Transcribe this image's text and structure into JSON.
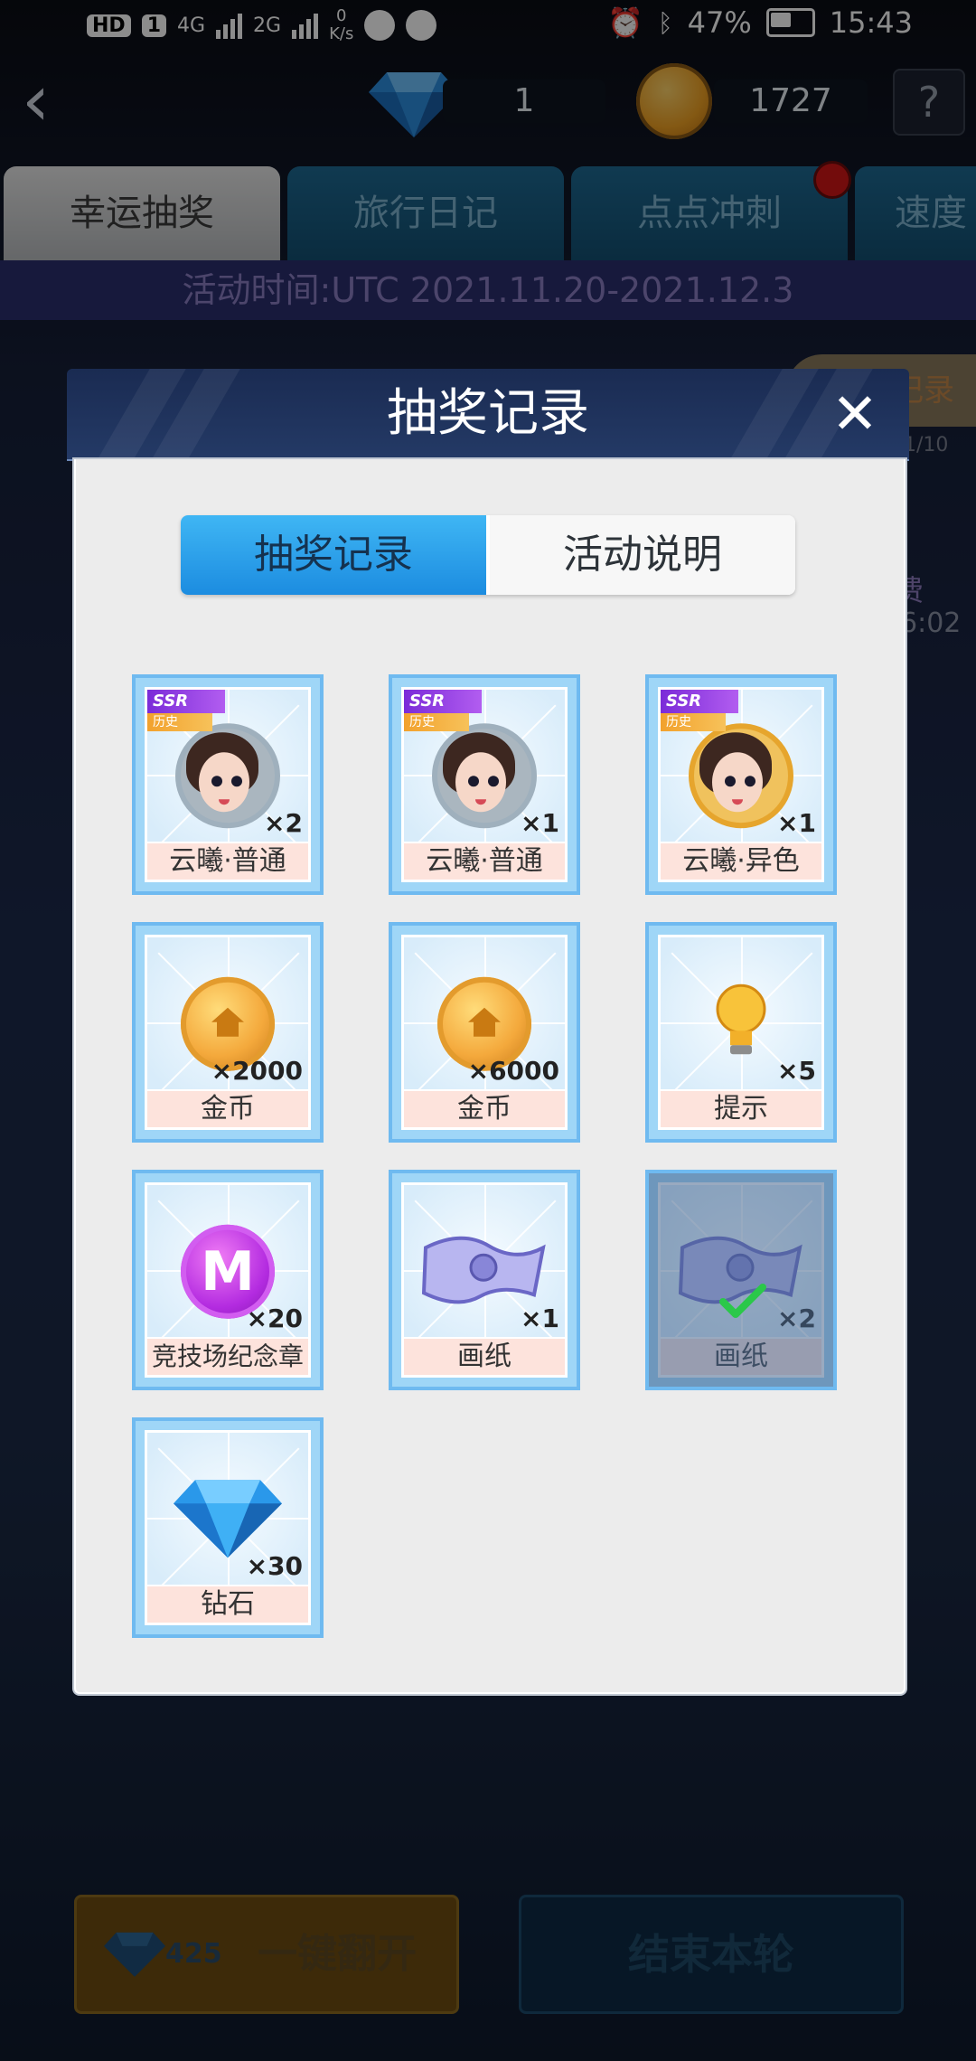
{
  "status_bar": {
    "hd": "HD",
    "sim1": "1",
    "net1": "4G",
    "net2": "2G",
    "speed_value": "0",
    "speed_unit": "K/s",
    "battery": "47%",
    "time": "15:43"
  },
  "top_bar": {
    "diamond_count": "1",
    "coin_count": "1727",
    "help_label": "?"
  },
  "tabs": [
    {
      "label": "幸运抽奖"
    },
    {
      "label": "旅行日记"
    },
    {
      "label": "点点冲刺"
    },
    {
      "label": "速度"
    }
  ],
  "event_time": "活动时间:UTC 2021.11.20-2021.12.3",
  "background_hints": {
    "side_chip": "记录",
    "count": "1/10",
    "fee": "费",
    "time": "6:02"
  },
  "modal": {
    "title": "抽奖记录",
    "close": "✕",
    "tabs": [
      "抽奖记录",
      "活动说明"
    ],
    "items": [
      {
        "name": "云曦·普通",
        "qty": "×2",
        "icon": "avatar-silver",
        "ssr": "SSR",
        "history": "历史"
      },
      {
        "name": "云曦·普通",
        "qty": "×1",
        "icon": "avatar-silver",
        "ssr": "SSR",
        "history": "历史"
      },
      {
        "name": "云曦·异色",
        "qty": "×1",
        "icon": "avatar-gold",
        "ssr": "SSR",
        "history": "历史"
      },
      {
        "name": "金币",
        "qty": "×2000",
        "icon": "coin"
      },
      {
        "name": "金币",
        "qty": "×6000",
        "icon": "coin"
      },
      {
        "name": "提示",
        "qty": "×5",
        "icon": "bulb"
      },
      {
        "name": "竞技场纪念章",
        "qty": "×20",
        "icon": "medal",
        "medal_letter": "M"
      },
      {
        "name": "画纸",
        "qty": "×1",
        "icon": "paper"
      },
      {
        "name": "画纸",
        "qty": "×2",
        "icon": "paper",
        "collected": true
      },
      {
        "name": "钻石",
        "qty": "×30",
        "icon": "diamond"
      }
    ]
  },
  "bottom": {
    "flip_cost": "425",
    "flip_label": "一键翻开",
    "end_label": "结束本轮"
  }
}
